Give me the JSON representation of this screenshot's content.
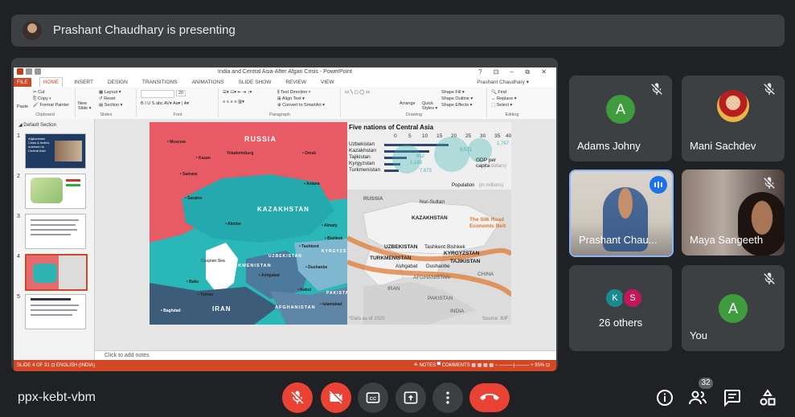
{
  "banner": {
    "text": "Prashant Chaudhary is presenting"
  },
  "ppt": {
    "window_title": "India and Central Asia-After Afgan Crisis - PowerPoint",
    "window_controls": "? ⊡ – ⧉ ✕",
    "tabs": [
      "FILE",
      "HOME",
      "INSERT",
      "DESIGN",
      "TRANSITIONS",
      "ANIMATIONS",
      "SLIDE SHOW",
      "REVIEW",
      "VIEW"
    ],
    "user": "Prashant Chaudhary ▾",
    "ribbon": {
      "clipboard": {
        "label": "Clipboard",
        "paste": "Paste",
        "cut": "✂ Cut",
        "copy": "⎘ Copy ▾",
        "format_painter": "🖌 Format Painter"
      },
      "slides": {
        "label": "Slides",
        "new_slide": "New Slide ▾",
        "layout": "▦ Layout ▾",
        "reset": "↺ Reset",
        "section": "▤ Section ▾"
      },
      "font": {
        "label": "Font",
        "size": "20",
        "row": "B  I  U  S  abc  AV▾  Aa▾  |  A▾"
      },
      "paragraph": {
        "label": "Paragraph",
        "text_direction": "⫼ Text Direction ▾",
        "align_text": "⊞ Align Text ▾",
        "smartart": "⊕ Convert to SmartArt ▾"
      },
      "drawing": {
        "label": "Drawing",
        "shapes": "▭ ╲ ▢ ◯ ▭",
        "arrange": "Arrange",
        "quick_styles": "Quick Styles ▾",
        "fill": "Shape Fill ▾",
        "outline": "Shape Outline ▾",
        "effects": "Shape Effects ▾"
      },
      "editing": {
        "label": "Editing",
        "find": "🔍 Find",
        "replace": "↔ Replace ▾",
        "select": "⬚ Select ▾"
      }
    },
    "section_label": "◢ Default Section",
    "thumb_numbers": [
      "1",
      "2",
      "3",
      "4",
      "5"
    ],
    "thumb1_title": "Afghanistan Crisis & India's outreach to Central Asia",
    "notes_placeholder": "Click to add notes",
    "status_left": "SLIDE 4 OF 31   ⊡   ENGLISH (INDIA)",
    "status_right": "≙ NOTES   ▀ COMMENTS   ▦ ▦ ▦ ▦   − ———|——— +  95%  ⊡"
  },
  "slide": {
    "chart_title": "Five nations of Central Asia",
    "axis": [
      "0",
      "5",
      "10",
      "15",
      "20",
      "25",
      "30",
      "35",
      "40"
    ],
    "countries": [
      "Uzbekistan",
      "Kazakhstan",
      "Tajikistan",
      "Kyrgyzstan",
      "Turkmenistan"
    ],
    "chart_labels": {
      "gdp": "GDP per capita",
      "gdp_sub": "(in dollars)",
      "pop": "Population",
      "pop_sub": "(in millions)",
      "v1": "1,767",
      "v2": "9,071",
      "v3": "852",
      "v4": "1,183",
      "v5": "7,673"
    },
    "map_left": {
      "russia": "RUSSIA",
      "kazakhstan": "KAZAKHSTAN",
      "iran": "IRAN",
      "turkmenistan": "TURKMENISTAN",
      "afghanistan": "AFGHANISTAN",
      "pakistan": "PAKISTAN",
      "uzbekistan": "UZBEKISTAN",
      "kyrgyzstan": "KYRGYZSTAN",
      "cities": [
        "• Moscow",
        "• Kazan",
        "Yekaterinburg",
        "• Omsk",
        "• Samara",
        "• Saratov",
        "• Astana",
        "• Aktobe",
        "• Baku",
        "• Tehran",
        "Caspian Sea",
        "• Ashgabat",
        "• Tashkent",
        "• Bishkek",
        "• Dushanbe",
        "• Kabul",
        "• Almaty",
        "• Islamabad",
        "• Baghdad"
      ]
    },
    "map_right": {
      "russia": "RUSSIA",
      "nur_sultan": "Nur-Sultan",
      "kazakhstan": "KAZAKHSTAN",
      "uzbekistan": "UZBEKISTAN",
      "tashkent": "Tashkent",
      "bishkek": "Bishkek",
      "kyrgyzstan": "KYRGYZSTAN",
      "turkmenistan": "TURKMENISTAN",
      "tajikistan": "TAJIKISTAN",
      "ashgabat": "Ashgabat",
      "dushanbe": "Dushanbe",
      "afghanistan": "AFGHANISTAN",
      "china": "CHINA",
      "iran": "IRAN",
      "pakistan": "PAKISTAN",
      "india": "INDIA",
      "silk_road": "The Silk Road Economic Belt",
      "data_as_of": "*Data as of 2020",
      "source": "Source: IMF"
    }
  },
  "participants": [
    {
      "name": "Adams Johny",
      "initial": "A",
      "color": "#3e9c3c"
    },
    {
      "name": "Mani Sachdev"
    },
    {
      "name": "Prashant Chau..."
    },
    {
      "name": "Maya Sangeeth"
    },
    {
      "name": "26 others",
      "minis": [
        {
          "letter": "K",
          "color": "#1a8a8f"
        },
        {
          "letter": "S",
          "color": "#c2185b"
        }
      ]
    },
    {
      "name": "You",
      "initial": "A",
      "color": "#3e9c3c"
    }
  ],
  "bottom": {
    "meeting_code": "ppx-kebt-vbm",
    "participant_count": "32",
    "icons": [
      "mic-off-icon",
      "camera-off-icon",
      "captions-icon",
      "present-icon",
      "more-options-icon",
      "hang-up-icon",
      "info-icon",
      "people-icon",
      "chat-icon",
      "activities-icon"
    ]
  },
  "colors": {
    "bg": "#202124",
    "tile": "#3c4043",
    "red": "#ea4335",
    "ppt_accent": "#d24726",
    "speaking": "#1a73e8"
  }
}
